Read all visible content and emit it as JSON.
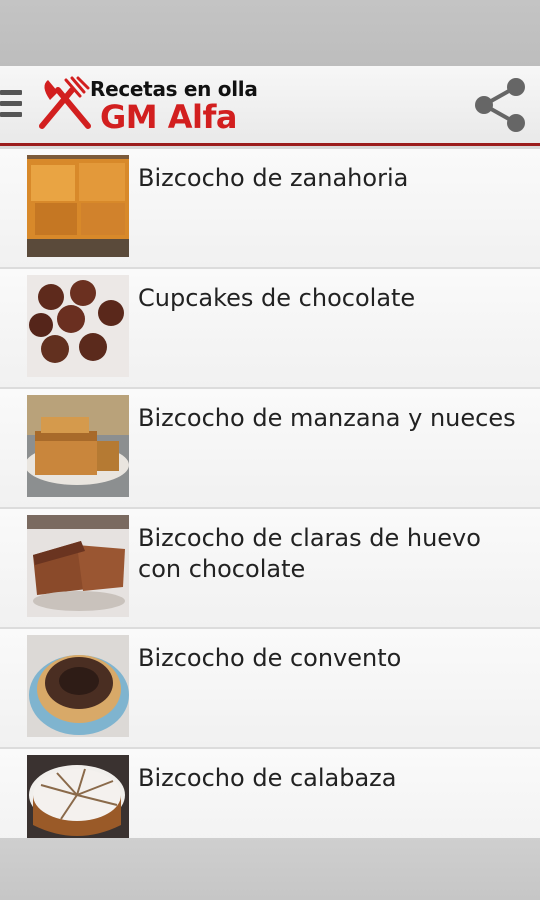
{
  "app": {
    "title_line1": "Recetas en olla",
    "title_line2": "GM Alfa",
    "brand_color": "#d21f1f"
  },
  "header": {
    "menu_icon": "menu-icon",
    "share_icon": "share-icon"
  },
  "recipes": [
    {
      "title": "Bizcocho de zanahoria",
      "thumbnail": "carrot-cake-photo"
    },
    {
      "title": "Cupcakes de chocolate",
      "thumbnail": "chocolate-cupcakes-photo"
    },
    {
      "title": "Bizcocho de manzana y nueces",
      "thumbnail": "apple-walnut-cake-photo"
    },
    {
      "title": "Bizcocho de claras de huevo con chocolate",
      "thumbnail": "egg-white-chocolate-cake-photo"
    },
    {
      "title": "Bizcocho de convento",
      "thumbnail": "convent-cake-photo"
    },
    {
      "title": "Bizcocho de calabaza",
      "thumbnail": "pumpkin-cake-photo"
    }
  ]
}
